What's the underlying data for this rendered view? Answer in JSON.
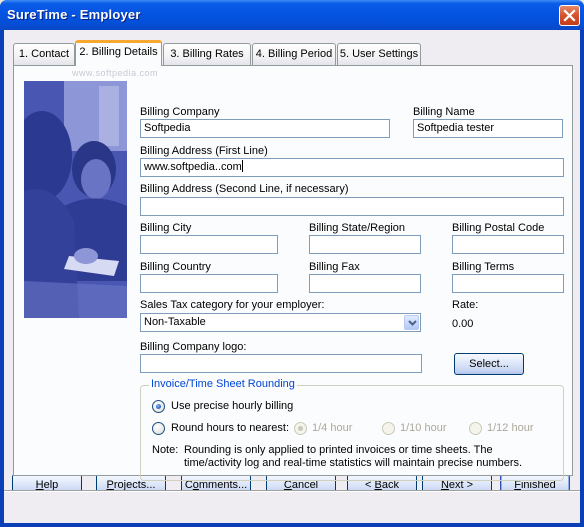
{
  "window": {
    "title": "SureTime - Employer",
    "close_icon": "close-icon"
  },
  "tabs": [
    {
      "label": "1. Contact",
      "active": false
    },
    {
      "label": "2. Billing Details",
      "active": true
    },
    {
      "label": "3. Billing Rates",
      "active": false
    },
    {
      "label": "4. Billing Period",
      "active": false
    },
    {
      "label": "5. User Settings",
      "active": false
    }
  ],
  "watermark": "www.softpedia.com",
  "form": {
    "billing_company": {
      "label": "Billing Company",
      "value": "Softpedia"
    },
    "billing_name": {
      "label": "Billing Name",
      "value": "Softpedia tester"
    },
    "address_line1": {
      "label": "Billing Address (First Line)",
      "value": "www.softpedia..com"
    },
    "address_line2": {
      "label": "Billing Address (Second Line, if necessary)",
      "value": ""
    },
    "city": {
      "label": "Billing City",
      "value": ""
    },
    "state": {
      "label": "Billing State/Region",
      "value": ""
    },
    "postal": {
      "label": "Billing Postal Code",
      "value": ""
    },
    "country": {
      "label": "Billing Country",
      "value": ""
    },
    "fax": {
      "label": "Billing Fax",
      "value": ""
    },
    "terms": {
      "label": "Billing Terms",
      "value": ""
    },
    "sales_tax": {
      "label": "Sales Tax category for your employer:",
      "selected": "Non-Taxable"
    },
    "rate": {
      "label": "Rate:",
      "value": "0.00"
    },
    "logo": {
      "label": "Billing Company logo:",
      "value": "",
      "select_button": "Select..."
    }
  },
  "rounding": {
    "title": "Invoice/Time Sheet Rounding",
    "precise_label": "Use precise hourly billing",
    "round_label": "Round hours to nearest:",
    "selected_mode": "precise",
    "options": [
      {
        "label": "1/4 hour",
        "checked": true,
        "enabled": false
      },
      {
        "label": "1/10 hour",
        "checked": false,
        "enabled": false
      },
      {
        "label": "1/12 hour",
        "checked": false,
        "enabled": false
      }
    ],
    "note_prefix": "Note:",
    "note_line1": "Rounding is only applied to printed invoices or time sheets.  The",
    "note_line2": "time/activity log and real-time statistics will maintain precise numbers."
  },
  "buttons": {
    "help": {
      "pre": "",
      "u": "H",
      "post": "elp"
    },
    "projects": {
      "pre": "",
      "u": "P",
      "post": "rojects..."
    },
    "comments": {
      "pre": "C",
      "u": "o",
      "post": "mments..."
    },
    "cancel": {
      "pre": "",
      "u": "C",
      "post": "ancel"
    },
    "back": {
      "pre": "< ",
      "u": "B",
      "post": "ack"
    },
    "next": {
      "pre": "",
      "u": "N",
      "post": "ext >"
    },
    "finished": {
      "pre": "",
      "u": "F",
      "post": "inished"
    }
  }
}
